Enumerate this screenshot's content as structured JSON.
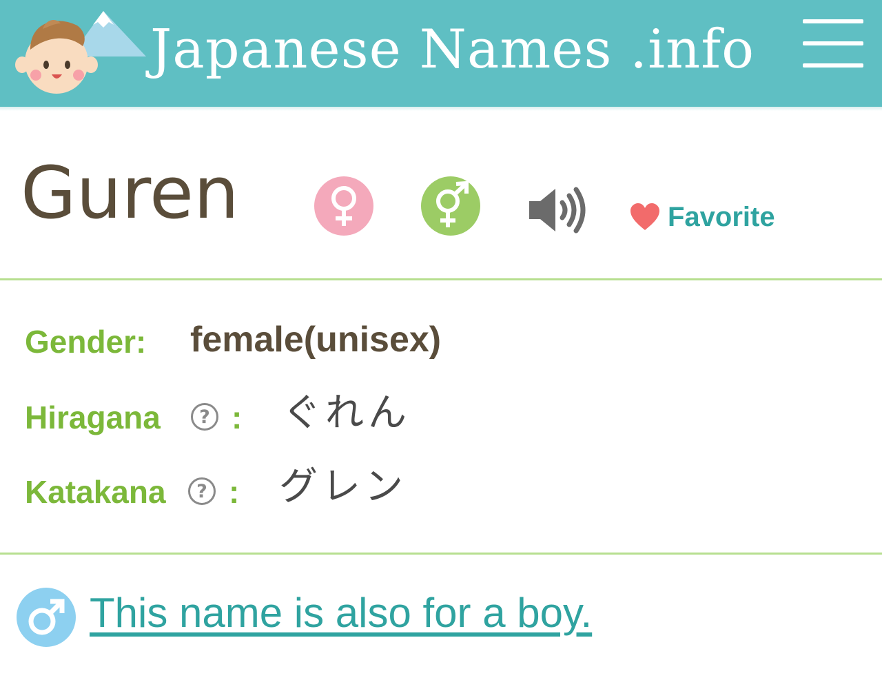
{
  "header": {
    "site_title": "Japanese Names .info",
    "menu_icon": "hamburger-menu-icon",
    "background_color": "#5fbfc3"
  },
  "name": {
    "title": "Guren",
    "icons": [
      "female-symbol-icon",
      "unisex-symbol-icon",
      "speaker-icon",
      "heart-icon"
    ],
    "favorite_label": "Favorite"
  },
  "details": {
    "gender_label": "Gender:",
    "gender_value": "female(unisex)",
    "hiragana_label": "Hiragana",
    "hiragana_value": "ぐれん",
    "katakana_label": "Katakana",
    "katakana_value": "グレン",
    "help_glyph": "?",
    "colon": ":"
  },
  "boy_link": {
    "text": "This name is also for a boy.",
    "icon": "male-symbol-icon"
  },
  "colors": {
    "accent_teal": "#2fa3a0",
    "label_green": "#7cb83a",
    "female_pink": "#f4a9bb",
    "unisex_green": "#9ccc65",
    "male_blue": "#8dd0f0",
    "heart_red": "#f26b6b"
  }
}
